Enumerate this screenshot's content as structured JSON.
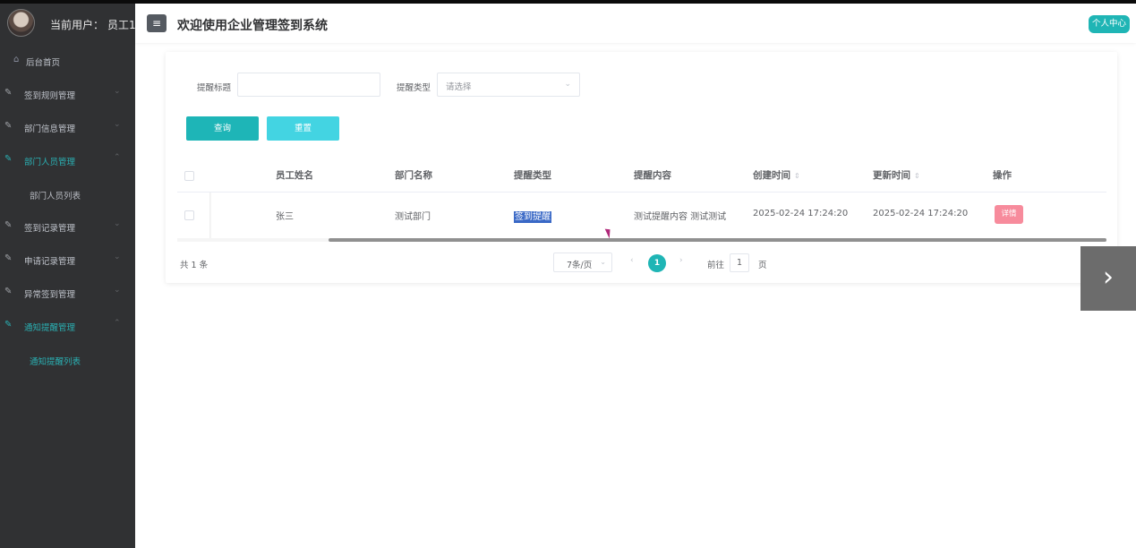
{
  "sidebar": {
    "user_label": "当前用户：",
    "user_name": "员工1",
    "menu": [
      {
        "label": "后台首页",
        "icon": "home-icon"
      },
      {
        "label": "签到规则管理",
        "icon": "edit-icon"
      },
      {
        "label": "部门信息管理",
        "icon": "edit-icon"
      },
      {
        "label": "部门人员管理",
        "icon": "edit-icon",
        "expanded": true
      },
      {
        "label": "部门人员列表"
      },
      {
        "label": "签到记录管理",
        "icon": "edit-icon"
      },
      {
        "label": "申请记录管理",
        "icon": "edit-icon"
      },
      {
        "label": "异常签到管理",
        "icon": "edit-icon"
      },
      {
        "label": "通知提醒管理",
        "icon": "edit-icon",
        "expanded": true,
        "active": true
      },
      {
        "label": "通知提醒列表",
        "active": true
      }
    ]
  },
  "header": {
    "menu_toggle_icon": "hamburger-icon",
    "title": "欢迎使用企业管理签到系统",
    "personal_button": "个人中心"
  },
  "filters": {
    "title_label": "提醒标题",
    "title_value": "",
    "type_label": "提醒类型",
    "type_placeholder": "请选择",
    "query_button": "查询",
    "reset_button": "重置"
  },
  "table": {
    "headers": {
      "name": "员工姓名",
      "dept": "部门名称",
      "type": "提醒类型",
      "content": "提醒内容",
      "created": "创建时间",
      "updated": "更新时间",
      "actions": "操作"
    },
    "rows": [
      {
        "name": "张三",
        "dept": "测试部门",
        "type": "签到提醒",
        "content": "测试提醒内容 测试测试",
        "created": "2025-02-24 17:24:20",
        "updated": "2025-02-24 17:24:20",
        "action": "详情"
      }
    ]
  },
  "pagination": {
    "total": "共 1 条",
    "page_size": "7条/页",
    "current_page": "1",
    "goto_label": "前往",
    "goto_value": "1",
    "goto_unit": "页"
  },
  "colors": {
    "accent": "#1fb5b5",
    "sidebar_bg": "#303133",
    "detail_button": "#f78b9c"
  }
}
